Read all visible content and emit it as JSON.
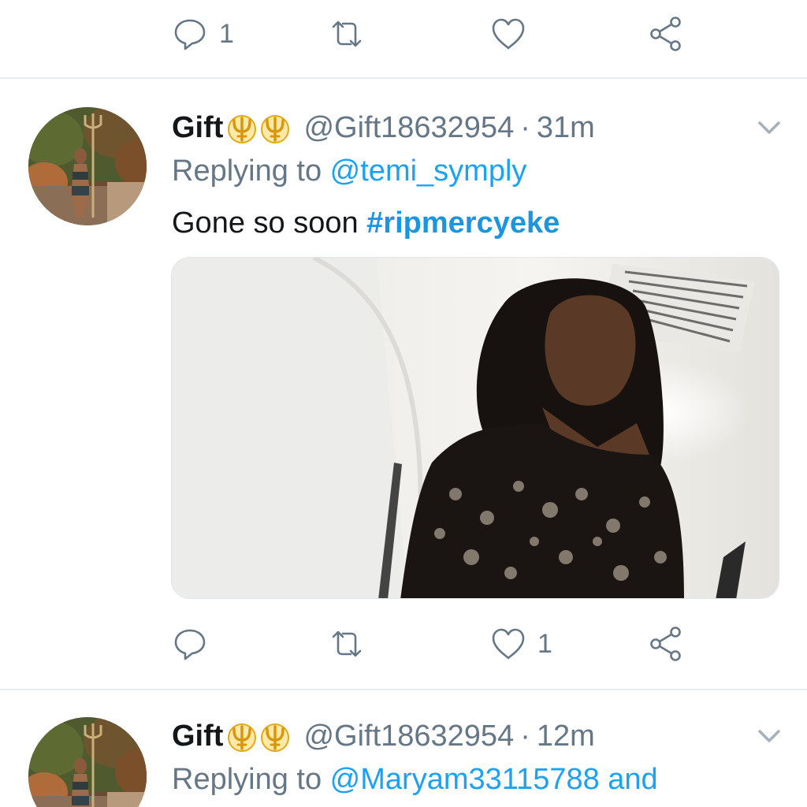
{
  "top_actions": {
    "reply_count": "1",
    "retweet_count": "",
    "like_count": ""
  },
  "tweets": [
    {
      "display_name": "Gift",
      "handle": "@Gift18632954",
      "separator": "·",
      "time": "31m",
      "replying_prefix": "Replying to ",
      "replying_to": "@temi_symply",
      "replying_suffix": "",
      "text": "Gone so soon ",
      "hashtag": "#ripmercyeke",
      "actions": {
        "reply_count": "",
        "retweet_count": "",
        "like_count": "1"
      }
    },
    {
      "display_name": "Gift",
      "handle": "@Gift18632954",
      "separator": "·",
      "time": "12m",
      "replying_prefix": "Replying to ",
      "replying_to": "@Maryam33115788",
      "replying_suffix": " and"
    }
  ],
  "icons": {
    "reply": "reply-icon",
    "retweet": "retweet-icon",
    "like": "heart-icon",
    "share": "share-icon",
    "menu": "chevron-down-icon",
    "badge": "trident-emoji-icon"
  },
  "colors": {
    "link": "#1da1f2",
    "hashtag": "#1b95e0",
    "muted": "#657786",
    "badge": "#e2a915"
  }
}
